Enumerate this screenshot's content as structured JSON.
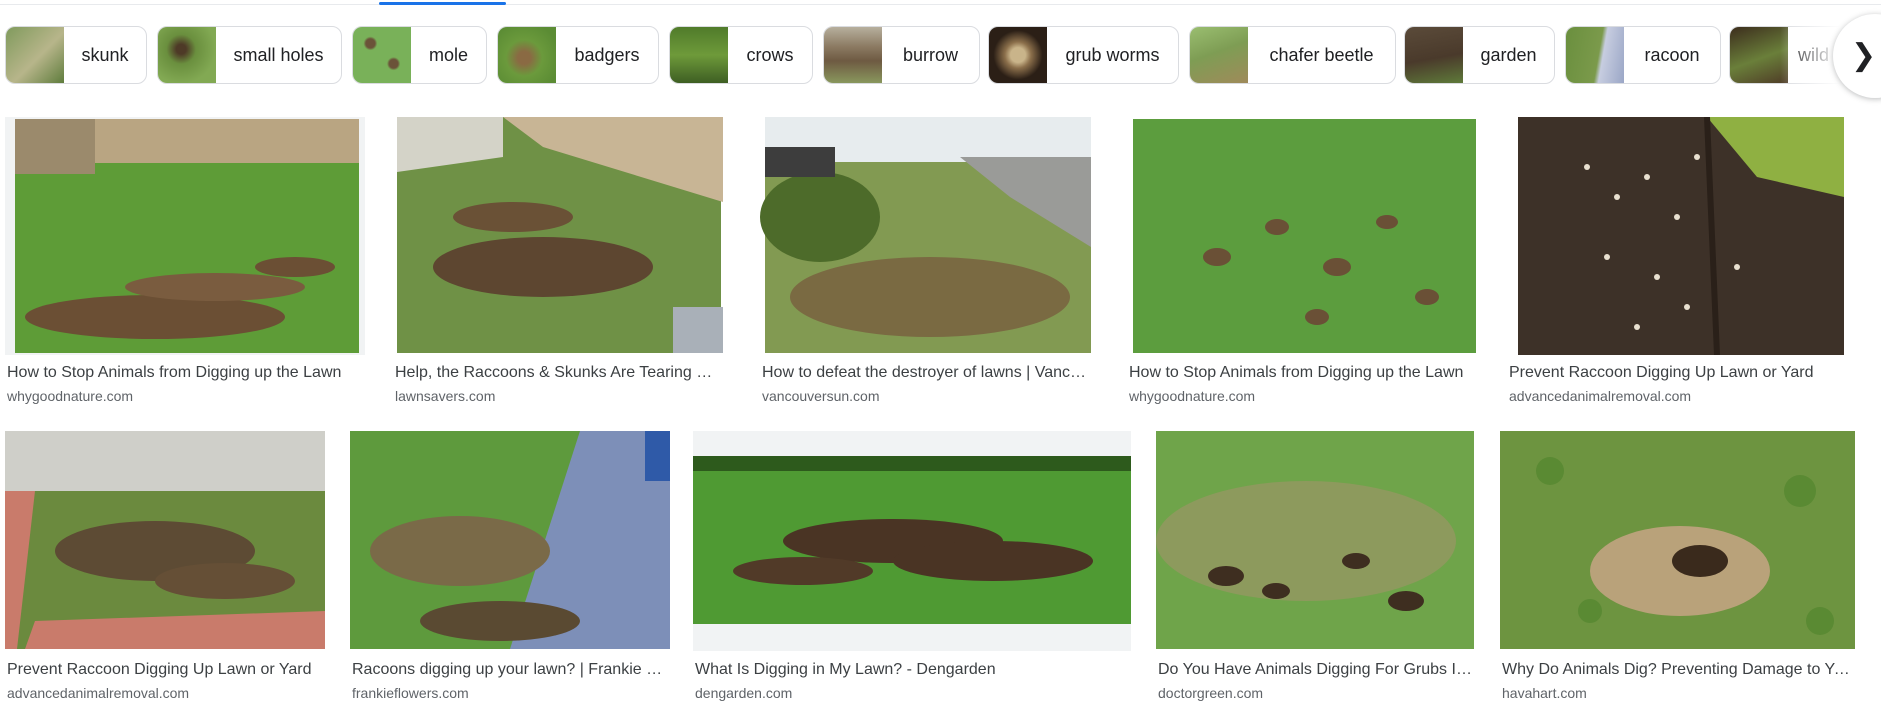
{
  "chips": [
    {
      "label": "skunk",
      "icon": "skunk-lawn-thumbnail"
    },
    {
      "label": "small holes",
      "icon": "small-holes-thumbnail"
    },
    {
      "label": "mole",
      "icon": "mole-thumbnail"
    },
    {
      "label": "badgers",
      "icon": "badgers-thumbnail"
    },
    {
      "label": "crows",
      "icon": "crows-thumbnail"
    },
    {
      "label": "burrow",
      "icon": "burrow-thumbnail"
    },
    {
      "label": "grub worms",
      "icon": "grub-worms-thumbnail"
    },
    {
      "label": "chafer beetle",
      "icon": "chafer-beetle-thumbnail"
    },
    {
      "label": "garden",
      "icon": "garden-thumbnail"
    },
    {
      "label": "racoon",
      "icon": "racoon-thumbnail"
    },
    {
      "label": "wild",
      "icon": "wild-thumbnail"
    }
  ],
  "next_icon": "chevron-right-icon",
  "results_row1": [
    {
      "title": "How to Stop Animals from Digging up the Lawn",
      "source": "whygoodnature.com"
    },
    {
      "title": "Help, the Raccoons & Skunks Are Tearing Up ...",
      "source": "lawnsavers.com"
    },
    {
      "title": "How to defeat the destroyer of lawns | Vancou...",
      "source": "vancouversun.com"
    },
    {
      "title": "How to Stop Animals from Digging up the Lawn",
      "source": "whygoodnature.com"
    },
    {
      "title": "Prevent Raccoon Digging Up Lawn or Yard",
      "source": "advancedanimalremoval.com"
    }
  ],
  "results_row2": [
    {
      "title": "Prevent Raccoon Digging Up Lawn or Yard",
      "source": "advancedanimalremoval.com"
    },
    {
      "title": "Racoons digging up your lawn? | Frankie Fl...",
      "source": "frankieflowers.com"
    },
    {
      "title": "What Is Digging in My Lawn? - Dengarden",
      "source": "dengarden.com"
    },
    {
      "title": "Do You Have Animals Digging For Grubs In ...",
      "source": "doctorgreen.com"
    },
    {
      "title": "Why Do Animals Dig? Preventing Damage to You...",
      "source": "havahart.com"
    }
  ],
  "colors": {
    "accent": "#1a73e8",
    "grass": "#5f9e3a",
    "grass_dark": "#3f7a25",
    "soil": "#4a3424",
    "title_text": "#3c4043",
    "source_text": "#5f6368"
  }
}
